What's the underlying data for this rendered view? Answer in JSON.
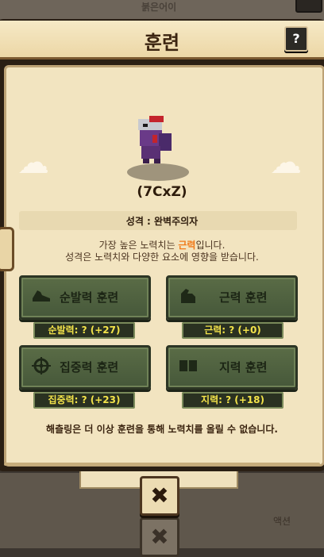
{
  "background": {
    "top_text": "붉은어이"
  },
  "dialog": {
    "title": "훈련",
    "help_label": "?",
    "character": {
      "name": "(7CxZ)",
      "personality": "성격 : 완벽주의자"
    },
    "info": {
      "line1_prefix": "가장 높은 노력치는 ",
      "line1_highlight": "근력",
      "line1_suffix": "입니다.",
      "line2": "성격은 노력치와 다양한 요소에 영향을 받습니다."
    },
    "training": [
      {
        "label": "순발력 훈련",
        "icon": "shoe-icon",
        "stat": "순발력: ? (+27)"
      },
      {
        "label": "근력 훈련",
        "icon": "muscle-arm-icon",
        "stat": "근력: ? (+0)"
      },
      {
        "label": "집중력 훈련",
        "icon": "crosshair-icon",
        "stat": "집중력: ? (+23)"
      },
      {
        "label": "지력 훈련",
        "icon": "book-icon",
        "stat": "지력: ? (+18)"
      }
    ],
    "bottom_message": "해츨링은 더 이상 훈련을 통해 노력치를 올릴 수 없습니다.",
    "close_label": "✖"
  },
  "colors": {
    "highlight": "#f07a1a",
    "stat_text": "#f3e34a",
    "button_green": "#4f6240"
  },
  "background_bottom": {
    "text": "액션"
  }
}
